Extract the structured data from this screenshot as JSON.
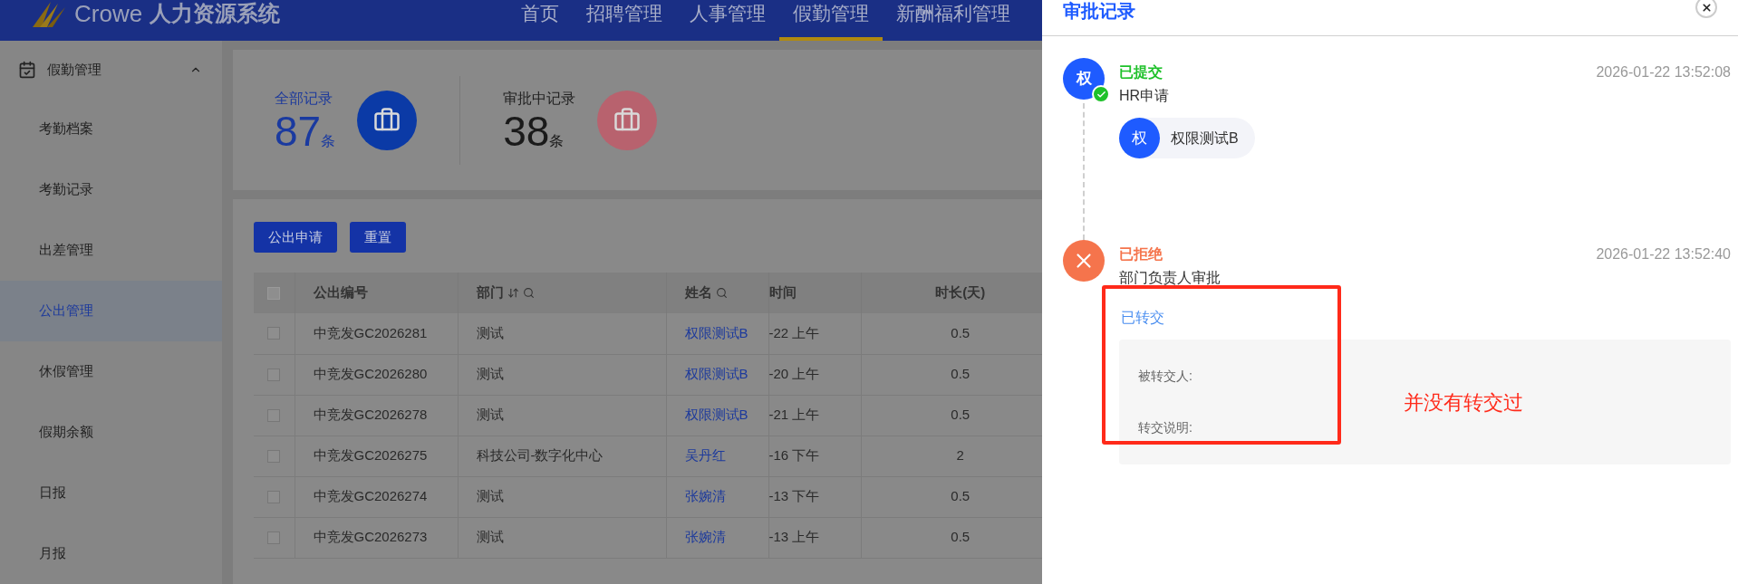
{
  "header": {
    "logo_text": "Crowe",
    "system_name": "人力资源系统",
    "nav": [
      {
        "label": "首页",
        "selected": false
      },
      {
        "label": "招聘管理",
        "selected": false
      },
      {
        "label": "人事管理",
        "selected": false
      },
      {
        "label": "假勤管理",
        "selected": true
      },
      {
        "label": "新酬福利管理",
        "selected": false
      }
    ]
  },
  "sidebar": {
    "group": {
      "label": "假勤管理",
      "expanded": true
    },
    "items": [
      {
        "label": "考勤档案",
        "selected": false
      },
      {
        "label": "考勤记录",
        "selected": false
      },
      {
        "label": "出差管理",
        "selected": false
      },
      {
        "label": "公出管理",
        "selected": true
      },
      {
        "label": "休假管理",
        "selected": false
      },
      {
        "label": "假期余额",
        "selected": false
      },
      {
        "label": "日报",
        "selected": false
      },
      {
        "label": "月报",
        "selected": false
      }
    ]
  },
  "stats": [
    {
      "kind": "all",
      "label": "全部记录",
      "value": "87",
      "unit": "条"
    },
    {
      "kind": "pending",
      "label": "审批中记录",
      "value": "38",
      "unit": "条"
    }
  ],
  "toolbar": {
    "buttons": [
      "公出申请",
      "重置"
    ]
  },
  "table": {
    "select_all": {
      "checked": false
    },
    "columns": [
      {
        "label": "公出编号",
        "sortable": false,
        "searchable": false
      },
      {
        "label": "部门",
        "sortable": true,
        "searchable": true
      },
      {
        "label": "姓名",
        "sortable": false,
        "searchable": true
      },
      {
        "label": "时间",
        "sortable": false,
        "searchable": false
      },
      {
        "label": "时长(天)",
        "sortable": false,
        "searchable": false
      }
    ],
    "rows": [
      {
        "checked": false,
        "cells": [
          "中竞发GC2026281",
          "测试",
          "权限测试B",
          "-22 上午",
          "0.5"
        ]
      },
      {
        "checked": false,
        "cells": [
          "中竞发GC2026280",
          "测试",
          "权限测试B",
          "-20 上午",
          "0.5"
        ]
      },
      {
        "checked": false,
        "cells": [
          "中竞发GC2026278",
          "测试",
          "权限测试B",
          "-21 上午",
          "0.5"
        ]
      },
      {
        "checked": false,
        "cells": [
          "中竞发GC2026275",
          "科技公司-数字化中心",
          "吴丹红",
          "-16 下午",
          "2"
        ]
      },
      {
        "checked": false,
        "cells": [
          "中竞发GC2026274",
          "测试",
          "张婉清",
          "-13 下午",
          "0.5"
        ]
      },
      {
        "checked": false,
        "cells": [
          "中竞发GC2026273",
          "测试",
          "张婉清",
          "-13 上午",
          "0.5"
        ]
      }
    ]
  },
  "drawer": {
    "title": "审批记录",
    "steps": [
      {
        "kind": "submitted",
        "avatar": "权",
        "status": "已提交",
        "node": "HR申请",
        "time": "2026-01-22 13:52:08",
        "approvers": [
          {
            "avatar": "权",
            "name": "权限测试B"
          }
        ]
      },
      {
        "kind": "rejected",
        "status": "已拒绝",
        "node": "部门负责人审批",
        "time": "2026-01-22 13:52:40",
        "transfer": {
          "title": "已转交",
          "fields": [
            "被转交人:",
            "转交说明:"
          ]
        }
      }
    ]
  },
  "annotation": {
    "text": "并没有转交过"
  }
}
